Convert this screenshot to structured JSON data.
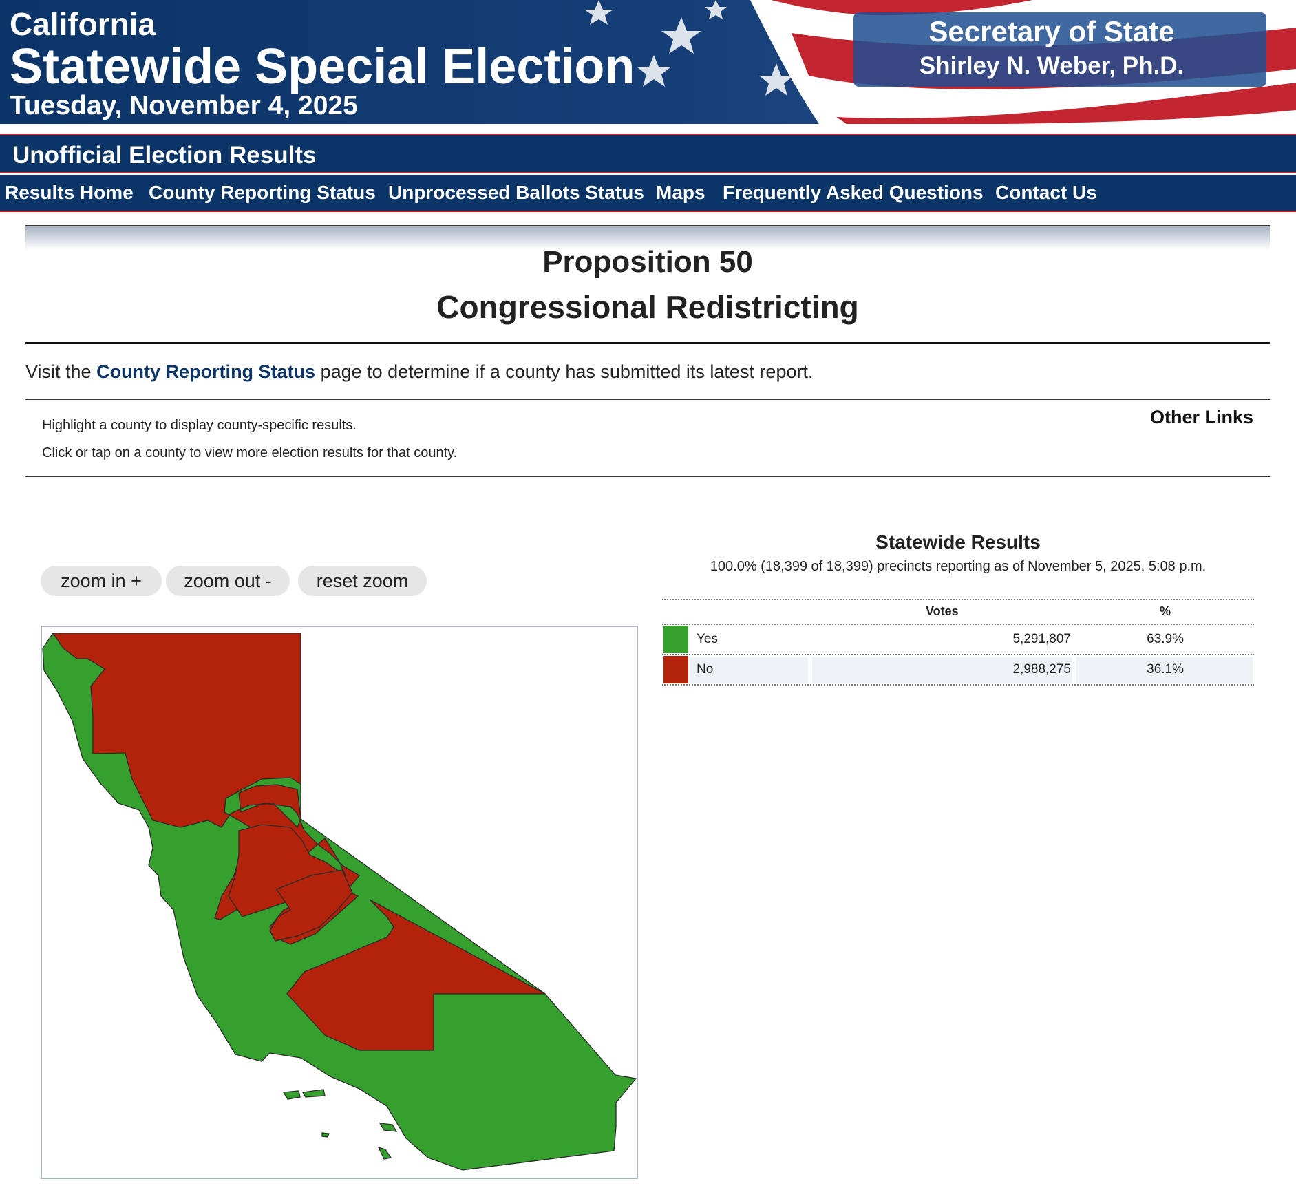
{
  "banner": {
    "state": "California",
    "election": "Statewide Special Election",
    "date": "Tuesday, November 4, 2025",
    "sos_title": "Secretary of State",
    "sos_name": "Shirley N. Weber, Ph.D."
  },
  "subtitle": "Unofficial Election Results",
  "nav": [
    "Results Home",
    "County Reporting Status",
    "Unprocessed Ballots Status",
    "Maps",
    "Frequently Asked Questions",
    "Contact Us"
  ],
  "page": {
    "title": "Proposition 50",
    "subtitle": "Congressional Redistricting"
  },
  "visit": {
    "prefix": "Visit the",
    "link": "County Reporting Status",
    "suffix": "page to determine if a county has submitted its latest report."
  },
  "info": {
    "line1": "Highlight a county to display county-specific results.",
    "line2": "Click or tap on a county to view more election results for that county.",
    "other_links": "Other Links"
  },
  "zoom": {
    "in": "zoom in +",
    "out": "zoom out -",
    "reset": "reset zoom"
  },
  "colors": {
    "navy": "#0b3467",
    "red_stripe": "#c32630",
    "yes": "#36a02f",
    "no": "#b3230c"
  },
  "results": {
    "title": "Statewide Results",
    "status": "100.0% (18,399 of 18,399) precincts reporting as of November 5, 2025, 5:08 p.m.",
    "headers": {
      "votes": "Votes",
      "pct": "%"
    },
    "rows": [
      {
        "label": "Yes",
        "votes": "5,291,807",
        "pct": "63.9%",
        "color": "#36a02f"
      },
      {
        "label": "No",
        "votes": "2,988,275",
        "pct": "36.1%",
        "color": "#b3230c"
      }
    ]
  }
}
